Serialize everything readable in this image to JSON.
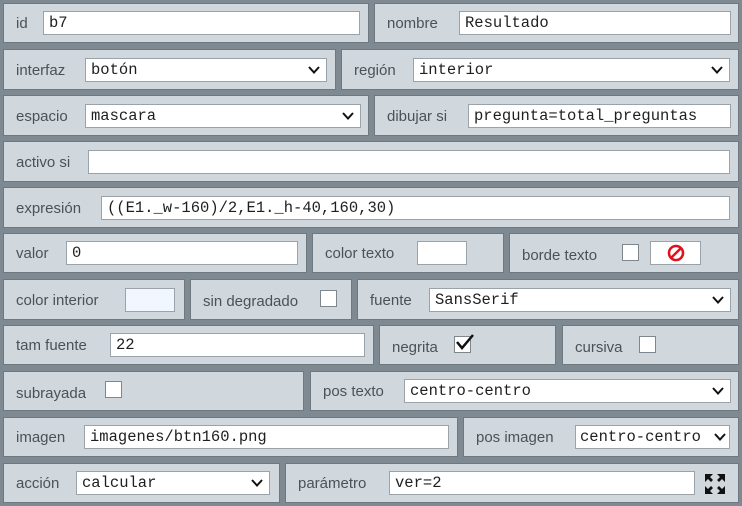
{
  "fields": {
    "id": {
      "label": "id",
      "value": "b7"
    },
    "nombre": {
      "label": "nombre",
      "value": "Resultado"
    },
    "interfaz": {
      "label": "interfaz",
      "value": "botón"
    },
    "region": {
      "label": "región",
      "value": "interior"
    },
    "espacio": {
      "label": "espacio",
      "value": "mascara"
    },
    "dibujar_si": {
      "label": "dibujar si",
      "value": "pregunta=total_preguntas"
    },
    "activo_si": {
      "label": "activo si",
      "value": ""
    },
    "expresion": {
      "label": "expresión",
      "value": "((E1._w-160)/2,E1._h-40,160,30)"
    },
    "valor": {
      "label": "valor",
      "value": "0"
    },
    "color_texto": {
      "label": "color texto",
      "color": "#ffffff"
    },
    "borde_texto": {
      "label": "borde texto",
      "checked": false,
      "button_icon": "no-entry-icon"
    },
    "color_interior": {
      "label": "color interior",
      "color": "#f2f6ff"
    },
    "sin_degradado": {
      "label": "sin degradado",
      "checked": false
    },
    "fuente": {
      "label": "fuente",
      "value": "SansSerif"
    },
    "tam_fuente": {
      "label": "tam fuente",
      "value": "22"
    },
    "negrita": {
      "label": "negrita",
      "checked": true
    },
    "cursiva": {
      "label": "cursiva",
      "checked": false
    },
    "subrayada": {
      "label": "subrayada",
      "checked": false
    },
    "pos_texto": {
      "label": "pos texto",
      "value": "centro-centro"
    },
    "imagen": {
      "label": "imagen",
      "value": "imagenes/btn160.png"
    },
    "pos_imagen": {
      "label": "pos imagen",
      "value": "centro-centro"
    },
    "accion": {
      "label": "acción",
      "value": "calcular"
    },
    "parametro": {
      "label": "parámetro",
      "value": "ver=2",
      "button_icon": "expand-icon"
    }
  }
}
